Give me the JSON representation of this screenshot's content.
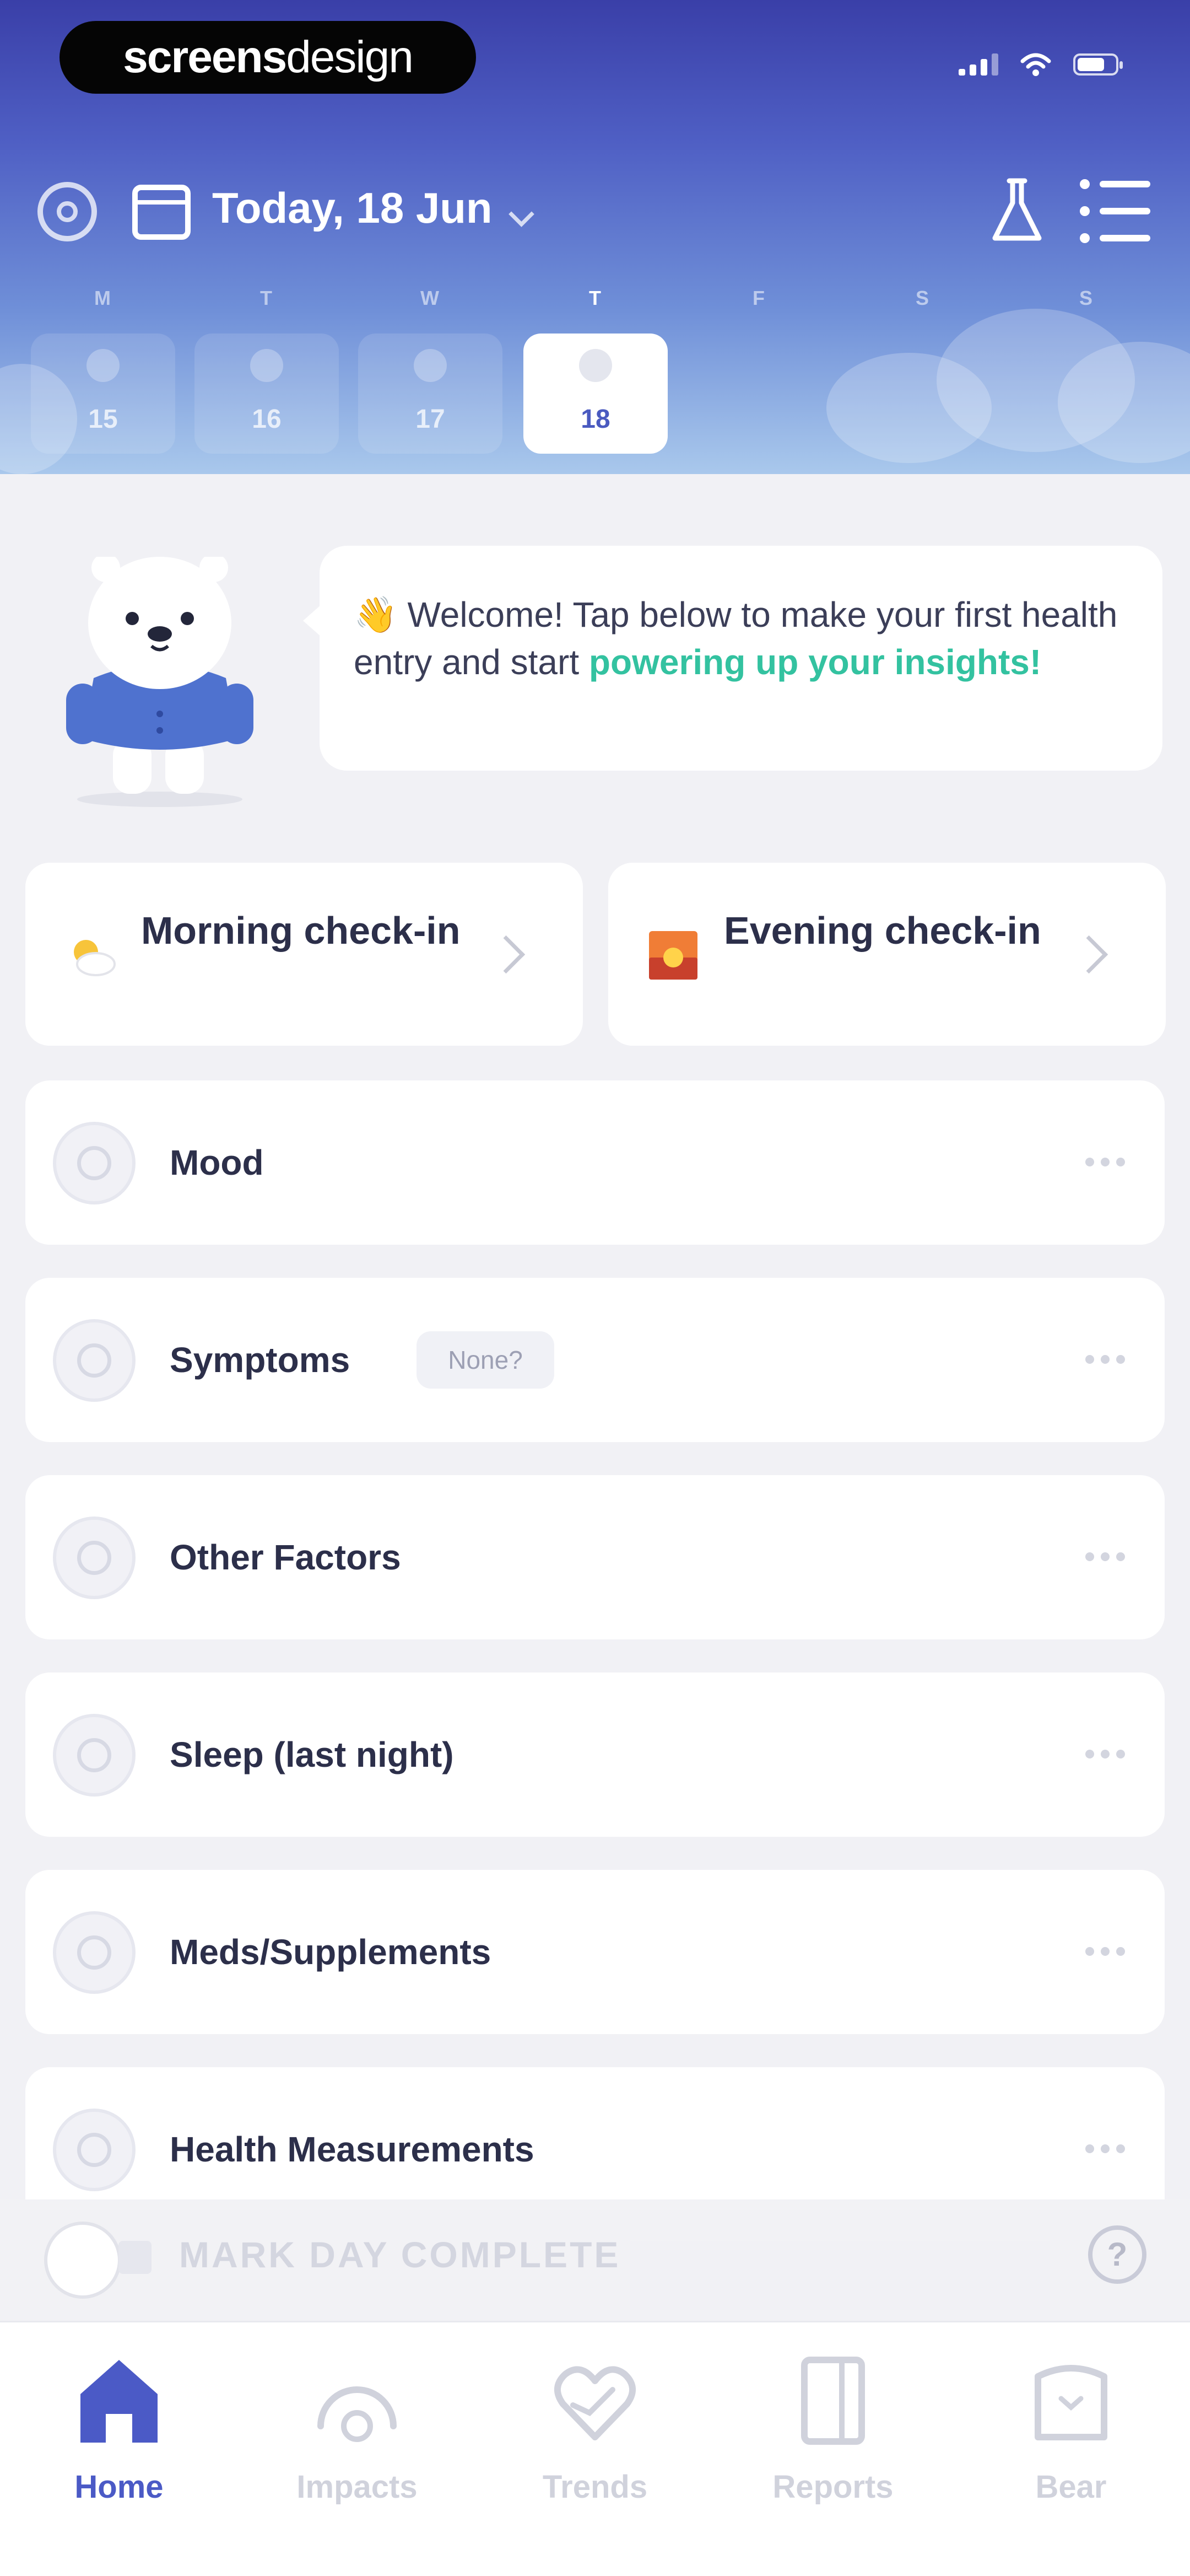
{
  "branding": {
    "watermark_bold": "screens",
    "watermark_light": "design"
  },
  "header": {
    "date_title": "Today, 18 Jun",
    "days": [
      {
        "weekday": "M",
        "date": "15"
      },
      {
        "weekday": "T",
        "date": "16"
      },
      {
        "weekday": "W",
        "date": "17"
      },
      {
        "weekday": "T",
        "date": "18"
      },
      {
        "weekday": "F",
        "date": ""
      },
      {
        "weekday": "S",
        "date": ""
      },
      {
        "weekday": "S",
        "date": ""
      }
    ]
  },
  "welcome": {
    "emoji": "👋",
    "text": "Welcome! Tap below to make your first health entry and start ",
    "highlight": "powering up your insights!"
  },
  "checkins": {
    "morning": {
      "emoji": "⛅",
      "label": "Morning check-in"
    },
    "evening": {
      "emoji": "🌇",
      "label": "Evening check-in"
    }
  },
  "rows": [
    {
      "label": "Mood",
      "badge": ""
    },
    {
      "label": "Symptoms",
      "badge": "None?"
    },
    {
      "label": "Other Factors",
      "badge": ""
    },
    {
      "label": "Sleep (last night)",
      "badge": ""
    },
    {
      "label": "Meds/Supplements",
      "badge": ""
    },
    {
      "label": "Health Measurements",
      "badge": ""
    }
  ],
  "footer": {
    "complete_label": "MARK DAY COMPLETE",
    "help_symbol": "?"
  },
  "tabs": [
    {
      "label": "Home",
      "icon": "home-icon",
      "active": true
    },
    {
      "label": "Impacts",
      "icon": "gauge-icon",
      "active": false
    },
    {
      "label": "Trends",
      "icon": "heart-trend-icon",
      "active": false
    },
    {
      "label": "Reports",
      "icon": "report-icon",
      "active": false
    },
    {
      "label": "Bear",
      "icon": "bear-icon",
      "active": false
    }
  ],
  "colors": {
    "accent": "#4b5ac6",
    "highlight": "#33c2a0",
    "header_top": "#3a3fa8",
    "header_bottom": "#a9c8ec"
  }
}
